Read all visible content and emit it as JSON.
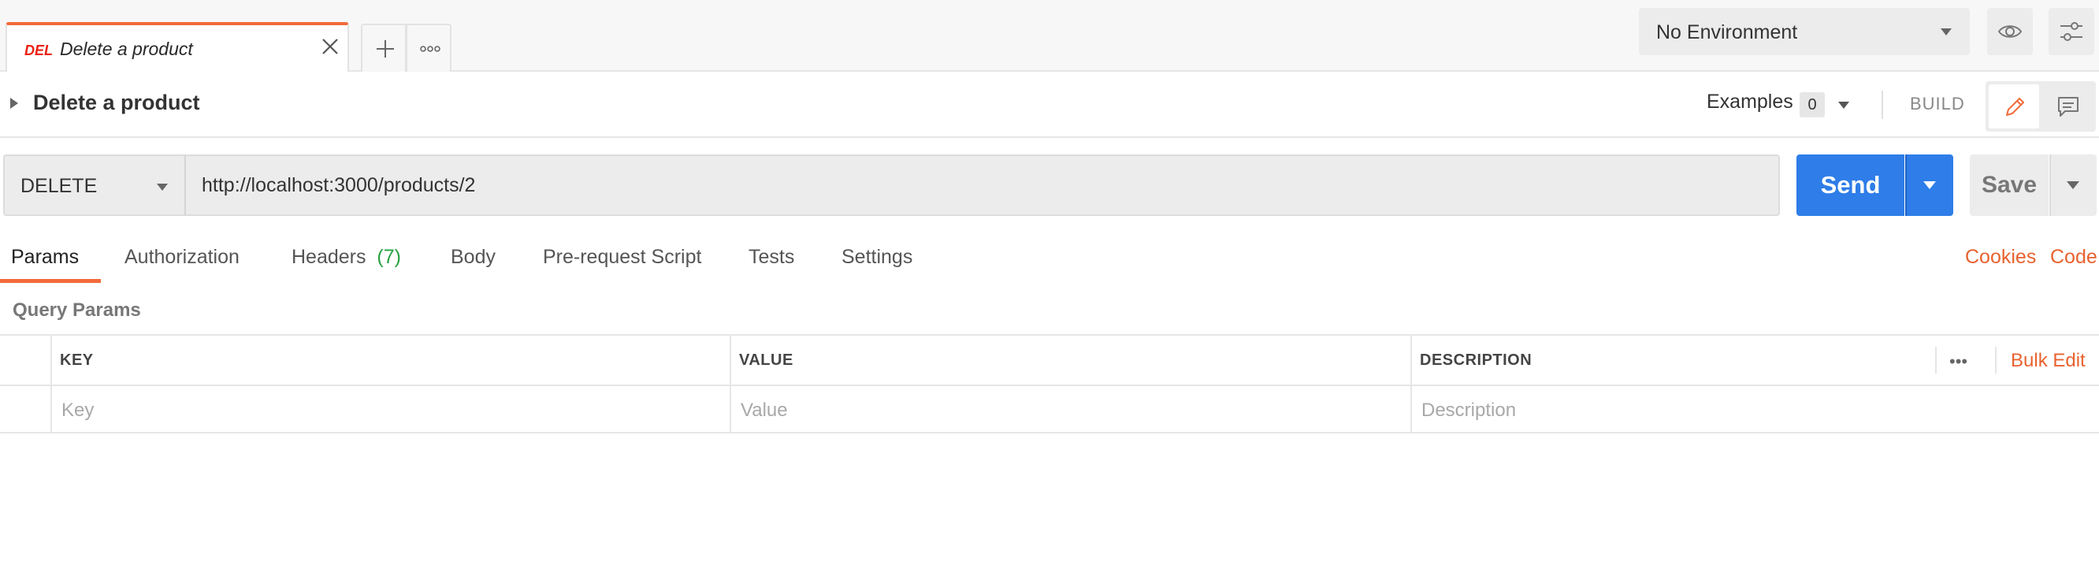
{
  "tab": {
    "method": "DEL",
    "title": "Delete a product"
  },
  "environment": {
    "selected": "No Environment"
  },
  "request": {
    "name": "Delete a product",
    "examples_label": "Examples",
    "examples_count": "0",
    "build_label": "BUILD",
    "method": "DELETE",
    "url": "http://localhost:3000/products/2",
    "send_label": "Send",
    "save_label": "Save"
  },
  "request_tabs": [
    {
      "label": "Params",
      "active": true
    },
    {
      "label": "Authorization"
    },
    {
      "label": "Headers",
      "count": "(7)"
    },
    {
      "label": "Body"
    },
    {
      "label": "Pre-request Script"
    },
    {
      "label": "Tests"
    },
    {
      "label": "Settings"
    }
  ],
  "links": {
    "cookies": "Cookies",
    "code": "Code"
  },
  "params": {
    "section_title": "Query Params",
    "columns": [
      "KEY",
      "VALUE",
      "DESCRIPTION"
    ],
    "placeholders": {
      "key": "Key",
      "value": "Value",
      "description": "Description"
    },
    "more_label": "•••",
    "bulk_edit_label": "Bulk Edit"
  },
  "colors": {
    "accent": "#f26b3a",
    "method_delete": "#eb2013",
    "send": "#2e7de8",
    "link": "#e8622f",
    "headers_count": "#26a244"
  }
}
